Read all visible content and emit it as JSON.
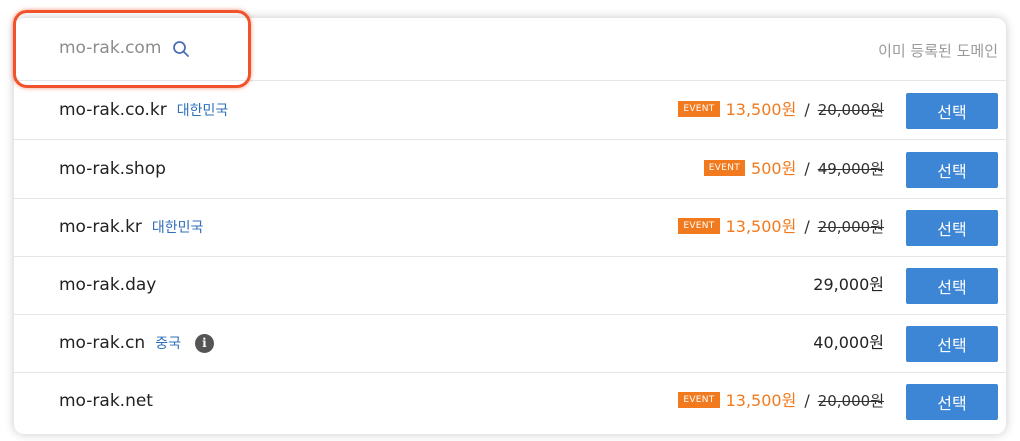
{
  "search": {
    "domain": "mo-rak.com",
    "icon": "search-icon"
  },
  "header": {
    "registered_text": "이미 등록된 도메인"
  },
  "rows": [
    {
      "name": "mo-rak.co.kr",
      "country": "대한민국",
      "event": "EVENT",
      "sale": "13,500원",
      "slash": "/",
      "original": "20,000원",
      "price": "",
      "button": "선택"
    },
    {
      "name": "mo-rak.shop",
      "country": "",
      "event": "EVENT",
      "sale": "500원",
      "slash": "/",
      "original": "49,000원",
      "price": "",
      "button": "선택"
    },
    {
      "name": "mo-rak.kr",
      "country": "대한민국",
      "event": "EVENT",
      "sale": "13,500원",
      "slash": "/",
      "original": "20,000원",
      "price": "",
      "button": "선택"
    },
    {
      "name": "mo-rak.day",
      "country": "",
      "event": "",
      "sale": "",
      "slash": "",
      "original": "",
      "price": "29,000원",
      "button": "선택"
    },
    {
      "name": "mo-rak.cn",
      "country": "중국",
      "info": "i",
      "event": "",
      "sale": "",
      "slash": "",
      "original": "",
      "price": "40,000원",
      "button": "선택"
    },
    {
      "name": "mo-rak.net",
      "country": "",
      "event": "EVENT",
      "sale": "13,500원",
      "slash": "/",
      "original": "20,000원",
      "price": "",
      "button": "선택"
    }
  ],
  "colors": {
    "accent": "#3d86d6",
    "event": "#f27a1e",
    "country": "#2f6fb8",
    "highlight": "#f0532b"
  }
}
